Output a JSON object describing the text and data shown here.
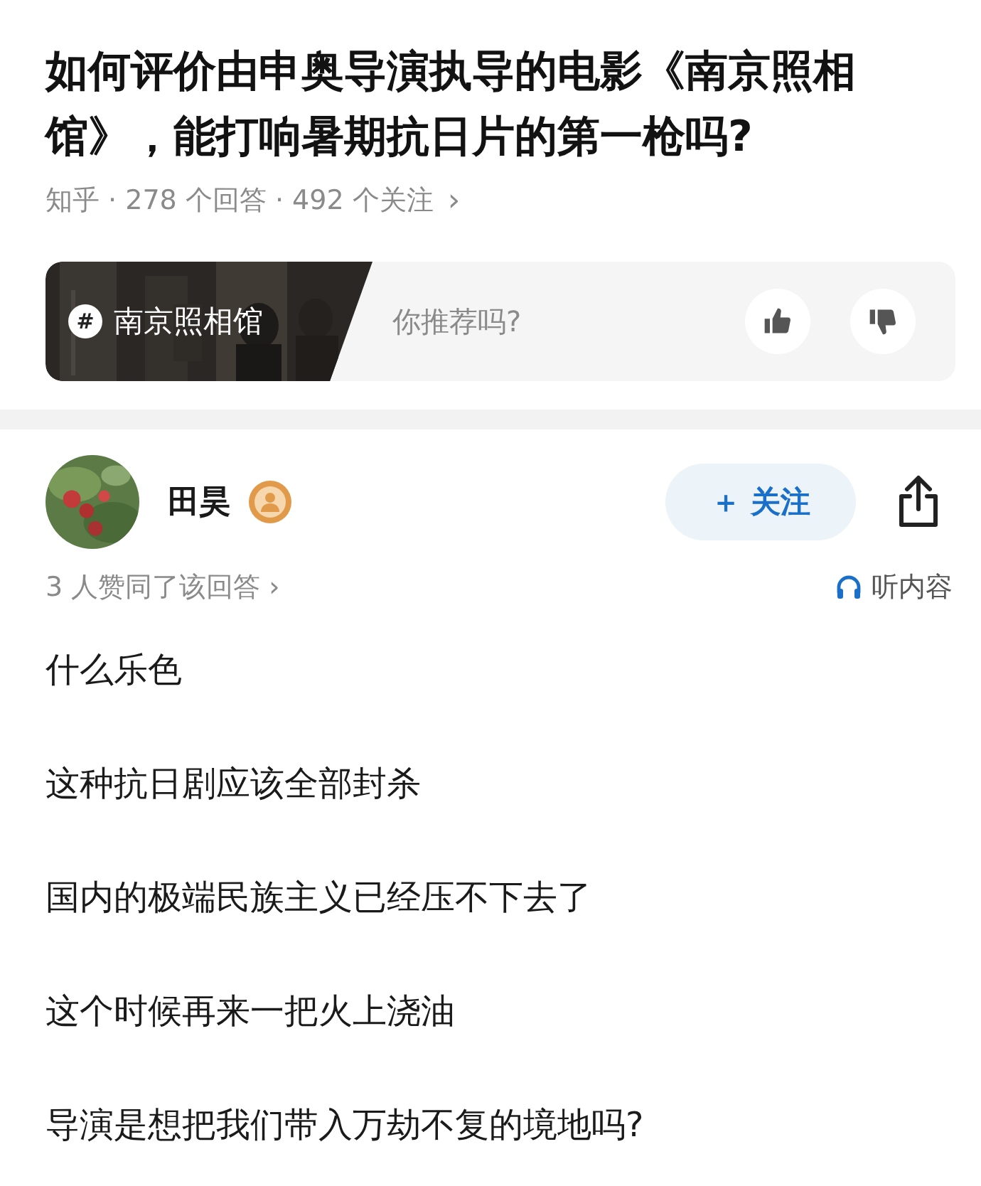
{
  "question": {
    "title": "如何评价由申奥导演执导的电影《南京照相馆》，能打响暑期抗日片的第一枪吗?",
    "meta": "知乎 · 278 个回答 · 492 个关注",
    "meta_chevron": "›"
  },
  "topic": {
    "mark": "#",
    "name": "南京照相馆",
    "prompt": "你推荐吗?"
  },
  "answer": {
    "author": "田昊",
    "follow_button": "＋ 关注",
    "votes": "3 人赞同了该回答 ›",
    "listen": "听内容",
    "paragraphs": [
      "什么乐色",
      "这种抗日剧应该全部封杀",
      "国内的极端民族主义已经压不下去了",
      "这个时候再来一把火上浇油",
      "导演是想把我们带入万劫不复的境地吗?"
    ]
  }
}
